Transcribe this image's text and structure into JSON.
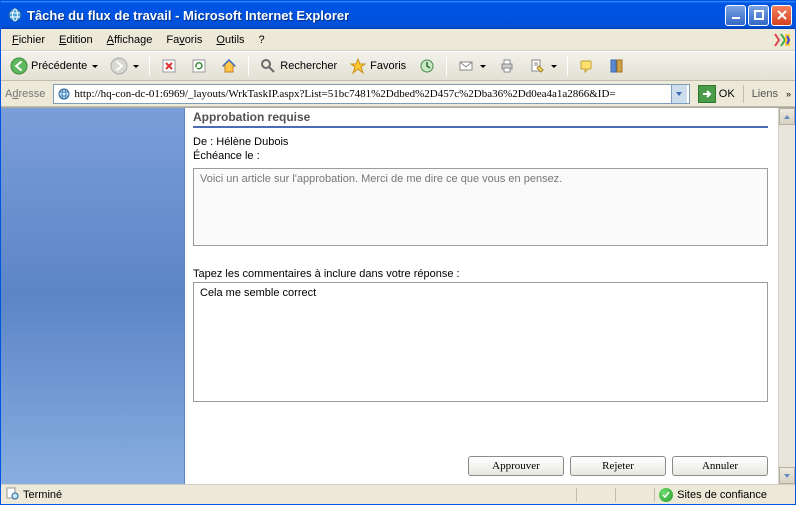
{
  "window": {
    "title": "Tâche du flux de travail - Microsoft Internet Explorer"
  },
  "menu": {
    "file": "Fichier",
    "edit": "Edition",
    "view": "Affichage",
    "favorites": "Favoris",
    "tools": "Outils",
    "help": "?"
  },
  "toolbar": {
    "back": "Précédente",
    "search": "Rechercher",
    "favorites": "Favoris"
  },
  "addressbar": {
    "label": "Adresse",
    "url": "http://hq-con-dc-01:6969/_layouts/WrkTaskIP.aspx?List=51bc7481%2Ddbed%2D457c%2Dba36%2Dd0ea4a1a2866&ID=",
    "go": "OK",
    "links": "Liens"
  },
  "form": {
    "title": "Approbation requise",
    "from_label": "De :",
    "from_value": "Hélène Dubois",
    "due_label": "Échéance le :",
    "message": "Voici un article sur l'approbation. Merci de me dire ce que vous en pensez.",
    "comment_label": "Tapez les commentaires à inclure dans votre réponse :",
    "comment_value": "Cela me semble correct"
  },
  "buttons": {
    "approve": "Approuver",
    "reject": "Rejeter",
    "cancel": "Annuler"
  },
  "status": {
    "done": "Terminé",
    "zone": "Sites de confiance"
  }
}
